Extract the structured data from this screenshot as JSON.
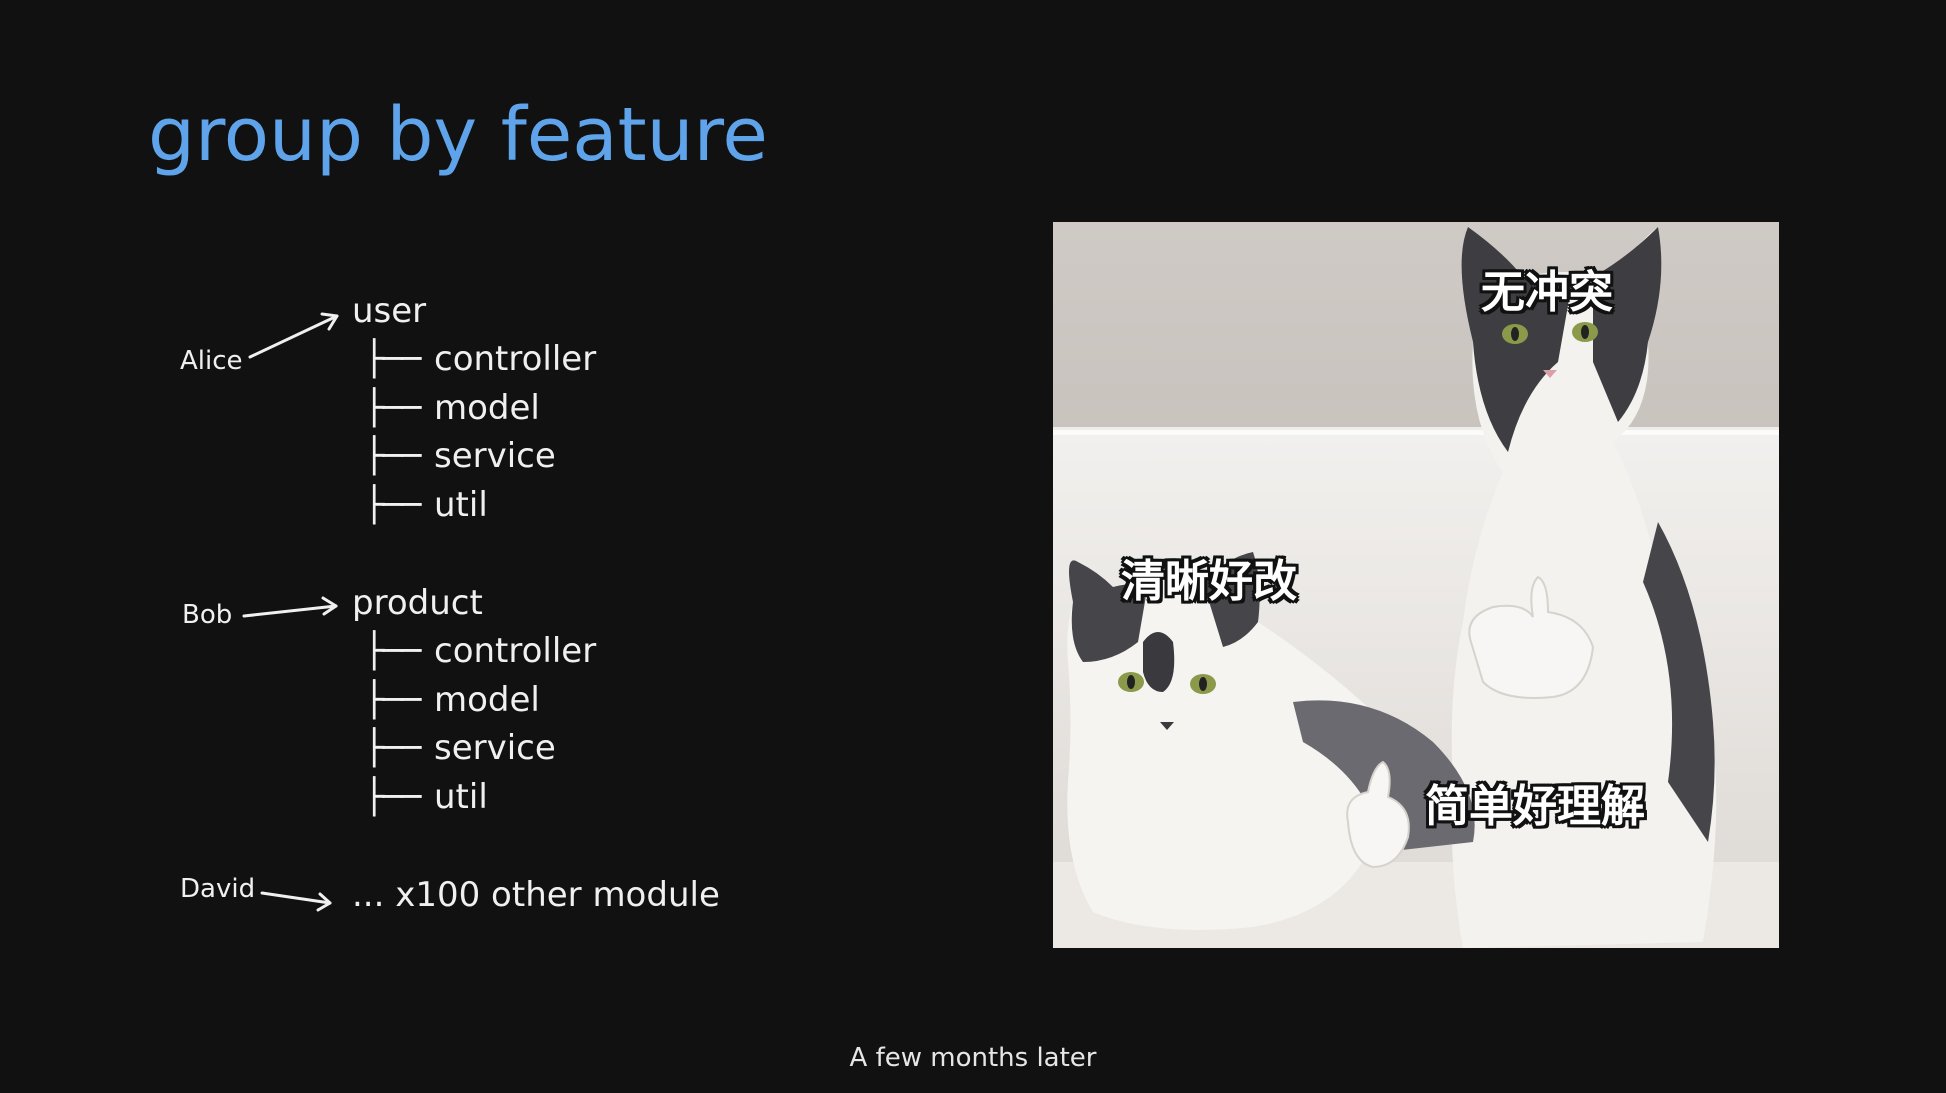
{
  "slide": {
    "title": "group by feature",
    "footer": "A few months later"
  },
  "tree": {
    "branch_glyph": "├──",
    "groups": [
      {
        "owner": "Alice",
        "root": "user",
        "children": [
          "controller",
          "model",
          "service",
          "util"
        ]
      },
      {
        "owner": "Bob",
        "root": "product",
        "children": [
          "controller",
          "model",
          "service",
          "util"
        ]
      },
      {
        "owner": "David",
        "root": "... x100 other module",
        "children": []
      }
    ]
  },
  "meme": {
    "captions": [
      "无冲突",
      "清晰好改",
      "简单好理解"
    ],
    "colors": {
      "title": "#5fa4ea",
      "background": "#111111"
    }
  }
}
